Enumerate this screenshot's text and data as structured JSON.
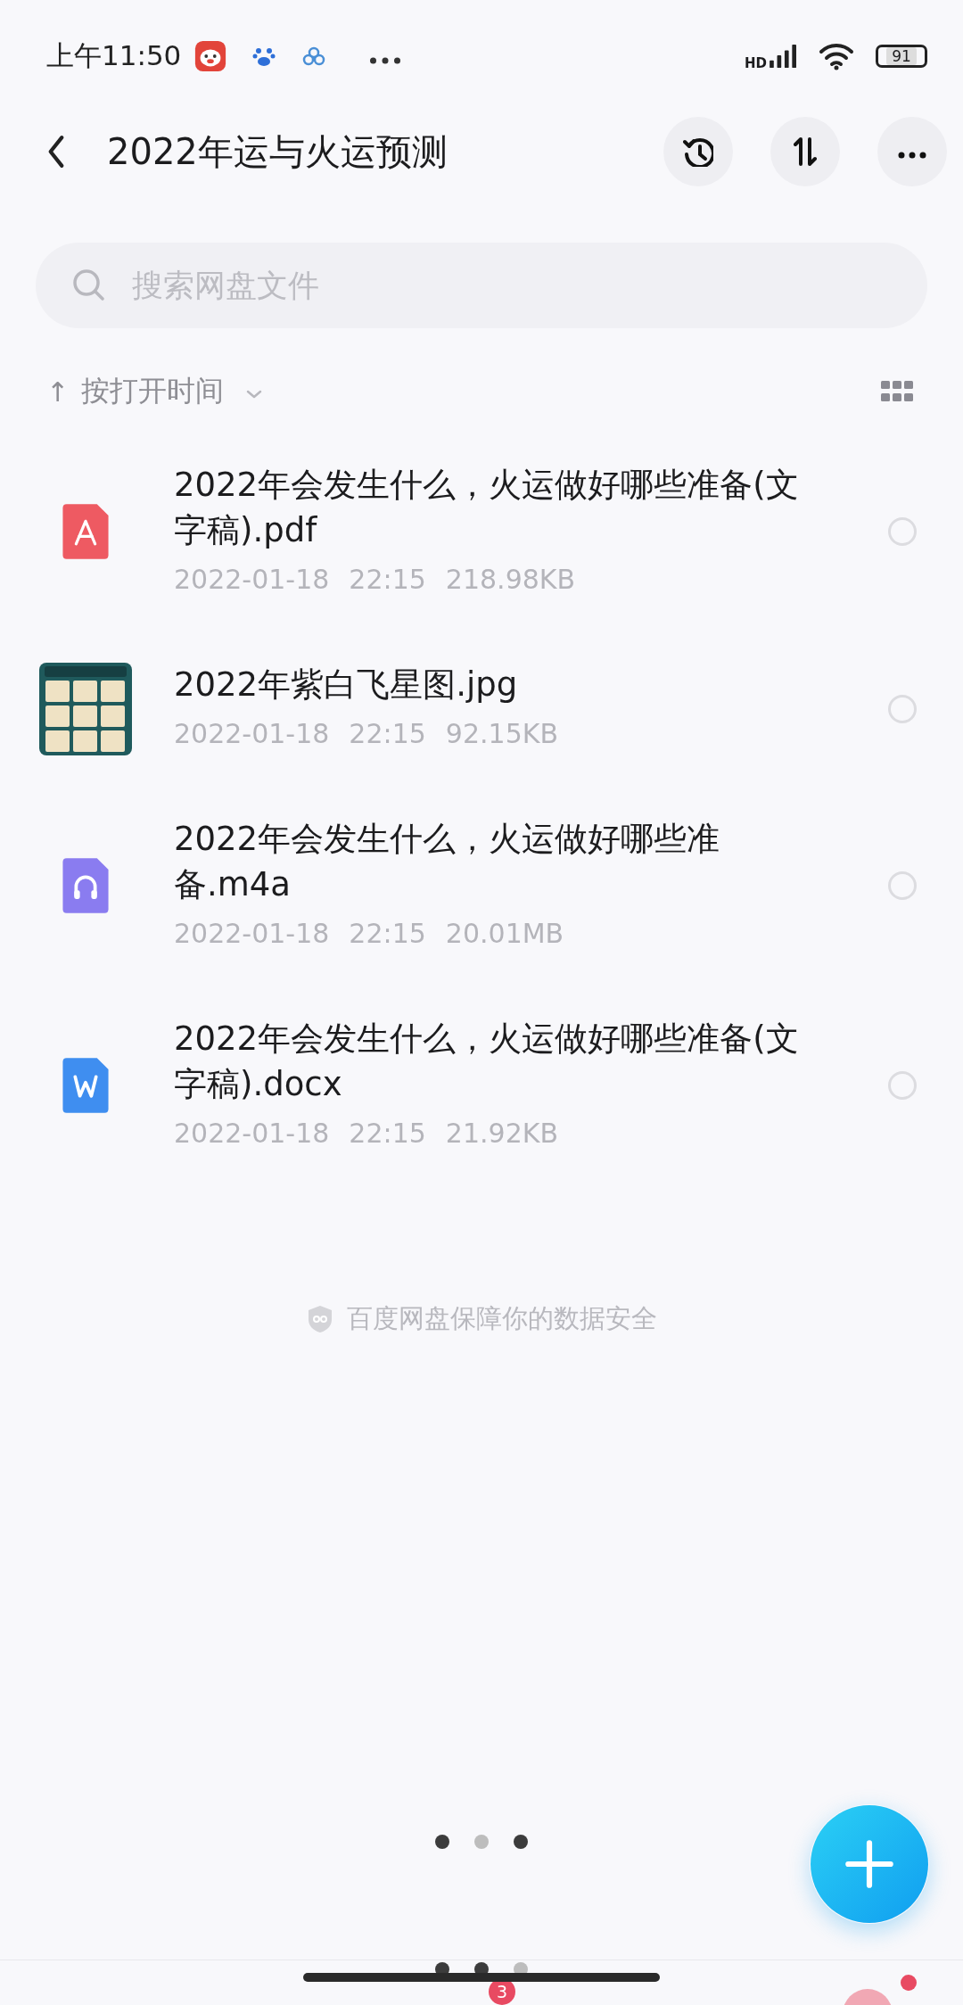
{
  "status_bar": {
    "time": "上午11:50",
    "network": "HD",
    "battery": "91"
  },
  "header": {
    "title": "2022年运与火运预测"
  },
  "search": {
    "placeholder": "搜索网盘文件"
  },
  "sort": {
    "arrow": "↑",
    "label": "按打开时间"
  },
  "files": [
    {
      "kind": "pdf",
      "name": "2022年会发生什么，火运做好哪些准备(文字稿).pdf",
      "date": "2022-01-18",
      "time": "22:15",
      "size": "218.98KB",
      "selected": false
    },
    {
      "name": "2022年紫白飞星图.jpg",
      "date": "2022-01-18",
      "time": "22:15",
      "size": "92.15KB",
      "selected": false
    },
    {
      "kind": "audio",
      "name": "2022年会发生什么，火运做好哪些准备.m4a",
      "date": "2022-01-18",
      "time": "22:15",
      "size": "20.01MB",
      "selected": false
    },
    {
      "kind": "word",
      "name": "2022年会发生什么，火运做好哪些准备(文字稿).docx",
      "date": "2022-01-18",
      "time": "22:15",
      "size": "21.92KB",
      "selected": false
    }
  ],
  "footer_note": "百度网盘保障你的数据安全",
  "page_dots": [
    {
      "selected": true
    },
    {
      "selected": false
    },
    {
      "selected": true
    }
  ],
  "bottom_nav": {
    "dots": [
      {
        "selected": true
      },
      {
        "selected": true
      },
      {
        "selected": false
      }
    ],
    "badge": "3"
  }
}
